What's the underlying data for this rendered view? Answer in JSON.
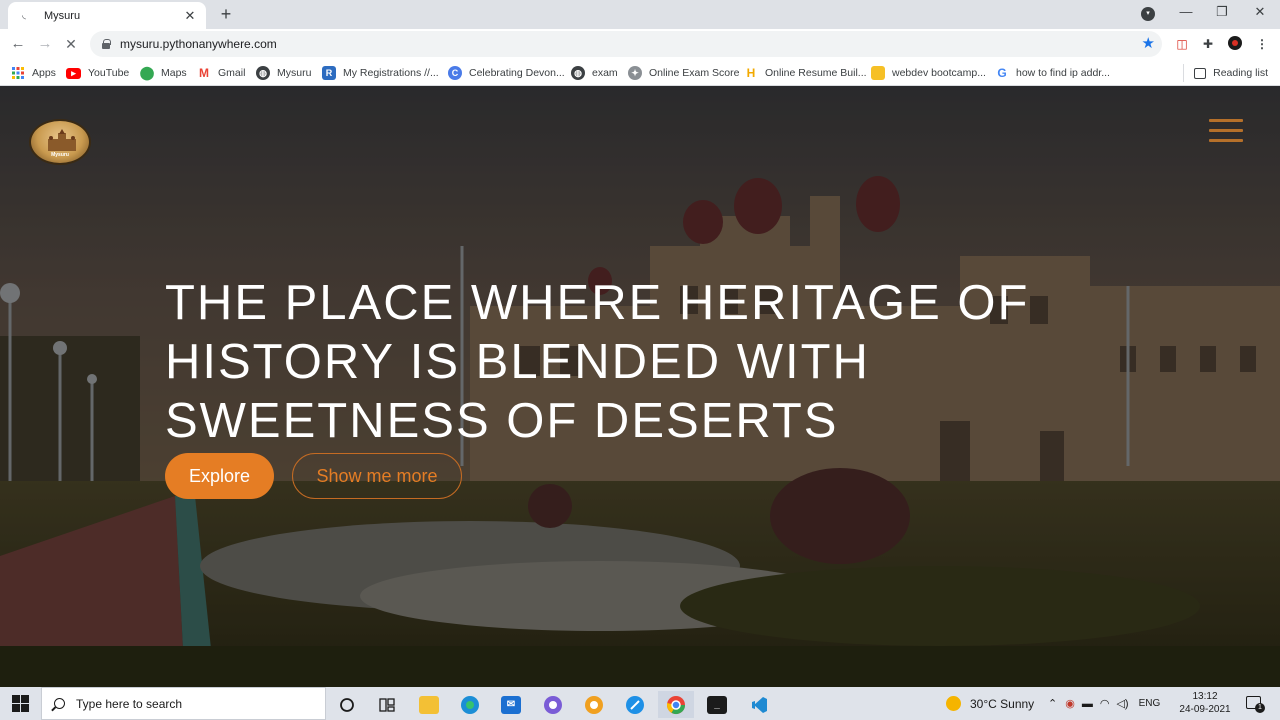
{
  "browser": {
    "tab_title": "Mysuru",
    "tab_favicon": "loading-spinner-icon",
    "url": "mysuru.pythonanywhere.com",
    "bookmarks": [
      {
        "label": "Apps",
        "icon": "apps-grid-icon"
      },
      {
        "label": "YouTube",
        "icon": "youtube-icon"
      },
      {
        "label": "Maps",
        "icon": "maps-pin-icon"
      },
      {
        "label": "Gmail",
        "icon": "gmail-icon"
      },
      {
        "label": "Mysuru",
        "icon": "globe-icon"
      },
      {
        "label": "My Registrations //...",
        "icon": "registration-icon"
      },
      {
        "label": "Celebrating Devon...",
        "icon": "c-logo-icon"
      },
      {
        "label": "exam",
        "icon": "globe-icon"
      },
      {
        "label": "Online Exam Score",
        "icon": "emblem-icon"
      },
      {
        "label": "Online Resume Buil...",
        "icon": "h-logo-icon"
      },
      {
        "label": "webdev bootcamp...",
        "icon": "folder-note-icon"
      },
      {
        "label": "how to find ip addr...",
        "icon": "google-icon"
      }
    ],
    "reading_list": "Reading list"
  },
  "page": {
    "logo_text": "Mysuru",
    "headline_lines": [
      "THE PLACE WHERE HERITAGE OF",
      "HISTORY IS BLENDED WITH",
      "SWEETNESS OF DESERTS"
    ],
    "explore_label": "Explore",
    "more_label": "Show me more",
    "accent_color": "#e57d24"
  },
  "taskbar": {
    "search_placeholder": "Type here to search",
    "weather": "30°C  Sunny",
    "language": "ENG",
    "time": "13:12",
    "date": "24-09-2021",
    "notification_count": "1"
  }
}
